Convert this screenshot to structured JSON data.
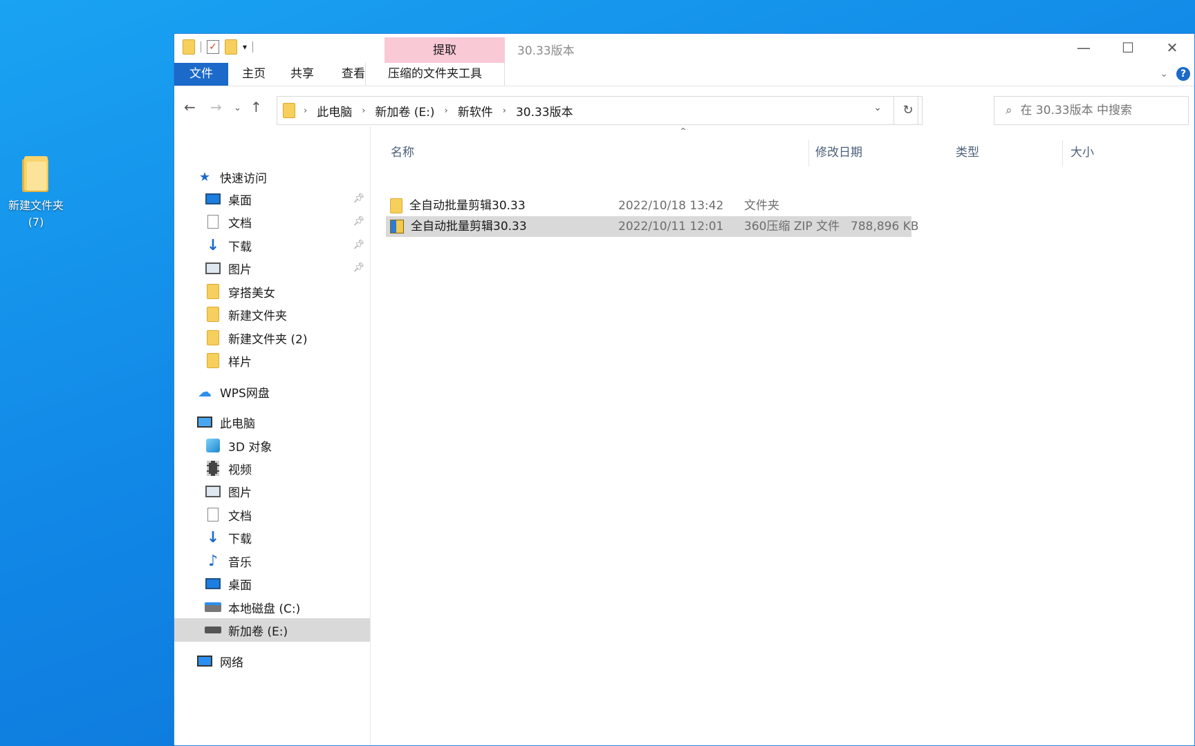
{
  "desktop": {
    "icon_label": "新建文件夹\n(7)",
    "icon_label_line1": "新建文件夹",
    "icon_label_line2": "(7)"
  },
  "window": {
    "title": "30.33版本",
    "context_tab": "提取",
    "tabs": {
      "file": "文件",
      "home": "主页",
      "share": "共享",
      "view": "查看",
      "tools": "压缩的文件夹工具"
    },
    "help": "?"
  },
  "address": {
    "crumbs": [
      "此电脑",
      "新加卷 (E:)",
      "新软件",
      "30.33版本"
    ]
  },
  "search": {
    "placeholder": "在 30.33版本 中搜索"
  },
  "nav": {
    "quick_access": "快速访问",
    "quick_items": [
      {
        "label": "桌面",
        "icon": "desktop-icon"
      },
      {
        "label": "文档",
        "icon": "document-icon"
      },
      {
        "label": "下载",
        "icon": "download-icon"
      },
      {
        "label": "图片",
        "icon": "picture-icon"
      },
      {
        "label": "穿搭美女",
        "icon": "folder-icon"
      },
      {
        "label": "新建文件夹",
        "icon": "folder-icon"
      },
      {
        "label": "新建文件夹 (2)",
        "icon": "folder-icon"
      },
      {
        "label": "样片",
        "icon": "folder-icon"
      }
    ],
    "wps": "WPS网盘",
    "this_pc": "此电脑",
    "pc_items": [
      {
        "label": "3D 对象",
        "icon": "3d-objects-icon"
      },
      {
        "label": "视频",
        "icon": "video-icon"
      },
      {
        "label": "图片",
        "icon": "picture-icon"
      },
      {
        "label": "文档",
        "icon": "document-icon"
      },
      {
        "label": "下载",
        "icon": "download-icon"
      },
      {
        "label": "音乐",
        "icon": "music-icon"
      },
      {
        "label": "桌面",
        "icon": "desktop-icon"
      },
      {
        "label": "本地磁盘 (C:)",
        "icon": "local-disk-icon"
      },
      {
        "label": "新加卷 (E:)",
        "icon": "drive-icon"
      }
    ],
    "network": "网络"
  },
  "columns": {
    "name": "名称",
    "date": "修改日期",
    "type": "类型",
    "size": "大小"
  },
  "files": [
    {
      "name": "全自动批量剪辑30.33",
      "date": "2022/10/18 13:42",
      "type": "文件夹",
      "size": "",
      "icon": "folder-icon"
    },
    {
      "name": "全自动批量剪辑30.33",
      "date": "2022/10/11 12:01",
      "type": "360压缩 ZIP 文件",
      "size": "788,896 KB",
      "icon": "zip-icon"
    }
  ]
}
